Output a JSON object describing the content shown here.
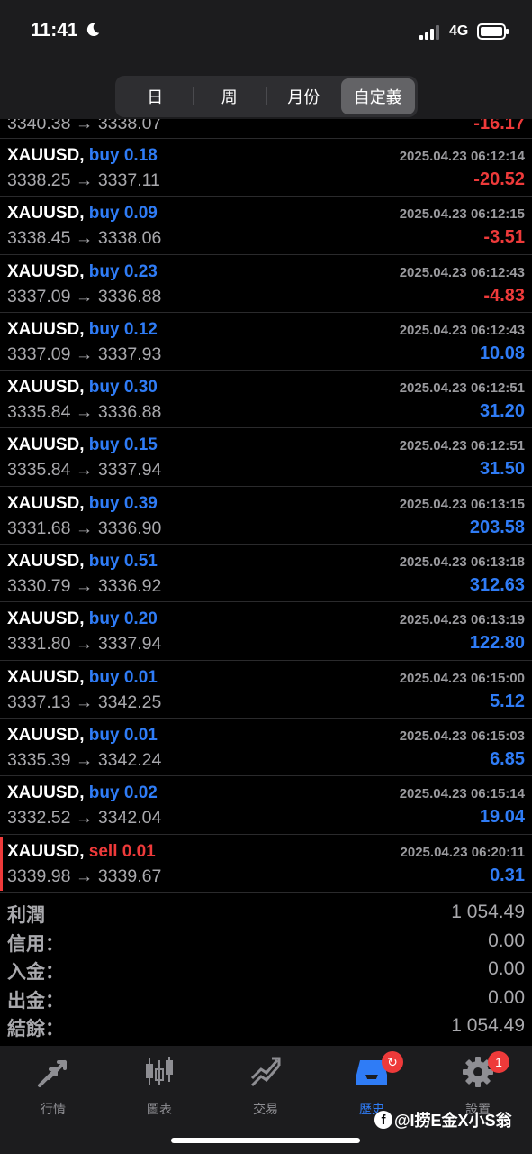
{
  "status_bar": {
    "time": "11:41",
    "network": "4G"
  },
  "header": {
    "segments": [
      "日",
      "周",
      "月份",
      "自定義"
    ],
    "active_segment": "自定義"
  },
  "partial_row": {
    "prices": "3340.38 → 3338.07",
    "profit": "-16.17"
  },
  "deals": [
    {
      "symbol": "XAUUSD,",
      "direction": "buy 0.18",
      "time": "2025.04.23 06:12:14",
      "prices": "3338.25 → 3337.11",
      "profit": "-20.52",
      "sign": "neg"
    },
    {
      "symbol": "XAUUSD,",
      "direction": "buy 0.09",
      "time": "2025.04.23 06:12:15",
      "prices": "3338.45 → 3338.06",
      "profit": "-3.51",
      "sign": "neg"
    },
    {
      "symbol": "XAUUSD,",
      "direction": "buy 0.23",
      "time": "2025.04.23 06:12:43",
      "prices": "3337.09 → 3336.88",
      "profit": "-4.83",
      "sign": "neg"
    },
    {
      "symbol": "XAUUSD,",
      "direction": "buy 0.12",
      "time": "2025.04.23 06:12:43",
      "prices": "3337.09 → 3337.93",
      "profit": "10.08",
      "sign": "pos"
    },
    {
      "symbol": "XAUUSD,",
      "direction": "buy 0.30",
      "time": "2025.04.23 06:12:51",
      "prices": "3335.84 → 3336.88",
      "profit": "31.20",
      "sign": "pos"
    },
    {
      "symbol": "XAUUSD,",
      "direction": "buy 0.15",
      "time": "2025.04.23 06:12:51",
      "prices": "3335.84 → 3337.94",
      "profit": "31.50",
      "sign": "pos"
    },
    {
      "symbol": "XAUUSD,",
      "direction": "buy 0.39",
      "time": "2025.04.23 06:13:15",
      "prices": "3331.68 → 3336.90",
      "profit": "203.58",
      "sign": "pos"
    },
    {
      "symbol": "XAUUSD,",
      "direction": "buy 0.51",
      "time": "2025.04.23 06:13:18",
      "prices": "3330.79 → 3336.92",
      "profit": "312.63",
      "sign": "pos"
    },
    {
      "symbol": "XAUUSD,",
      "direction": "buy 0.20",
      "time": "2025.04.23 06:13:19",
      "prices": "3331.80 → 3337.94",
      "profit": "122.80",
      "sign": "pos"
    },
    {
      "symbol": "XAUUSD,",
      "direction": "buy 0.01",
      "time": "2025.04.23 06:15:00",
      "prices": "3337.13 → 3342.25",
      "profit": "5.12",
      "sign": "pos"
    },
    {
      "symbol": "XAUUSD,",
      "direction": "buy 0.01",
      "time": "2025.04.23 06:15:03",
      "prices": "3335.39 → 3342.24",
      "profit": "6.85",
      "sign": "pos"
    },
    {
      "symbol": "XAUUSD,",
      "direction": "buy 0.02",
      "time": "2025.04.23 06:15:14",
      "prices": "3332.52 → 3342.04",
      "profit": "19.04",
      "sign": "pos"
    },
    {
      "symbol": "XAUUSD,",
      "direction": "sell 0.01",
      "time": "2025.04.23 06:20:11",
      "prices": "3339.98 → 3339.67",
      "profit": "0.31",
      "sign": "pos",
      "side": "sell"
    }
  ],
  "summary": [
    {
      "label": "利潤",
      "value": "1 054.49"
    },
    {
      "label": "信用：",
      "value": "0.00"
    },
    {
      "label": "入金：",
      "value": "0.00"
    },
    {
      "label": "出金：",
      "value": "0.00"
    },
    {
      "label": "結餘：",
      "value": "1 054.49"
    }
  ],
  "tabbar": {
    "tabs": [
      {
        "label": "行情",
        "icon": "quotes-arrows-icon"
      },
      {
        "label": "圖表",
        "icon": "candlestick-chart-icon"
      },
      {
        "label": "交易",
        "icon": "trade-trend-icon"
      },
      {
        "label": "歷史",
        "icon": "history-inbox-icon",
        "active": true
      },
      {
        "label": "設置",
        "icon": "settings-gear-icon"
      }
    ],
    "history_badge": "↻",
    "settings_badge": "1"
  },
  "watermark": {
    "text": "@I捞E金X小S翁"
  },
  "colors": {
    "buy_blue": "#2f7cf6",
    "sell_red": "#ee3a3a",
    "background": "#000000",
    "bar": "#1c1c1e"
  }
}
